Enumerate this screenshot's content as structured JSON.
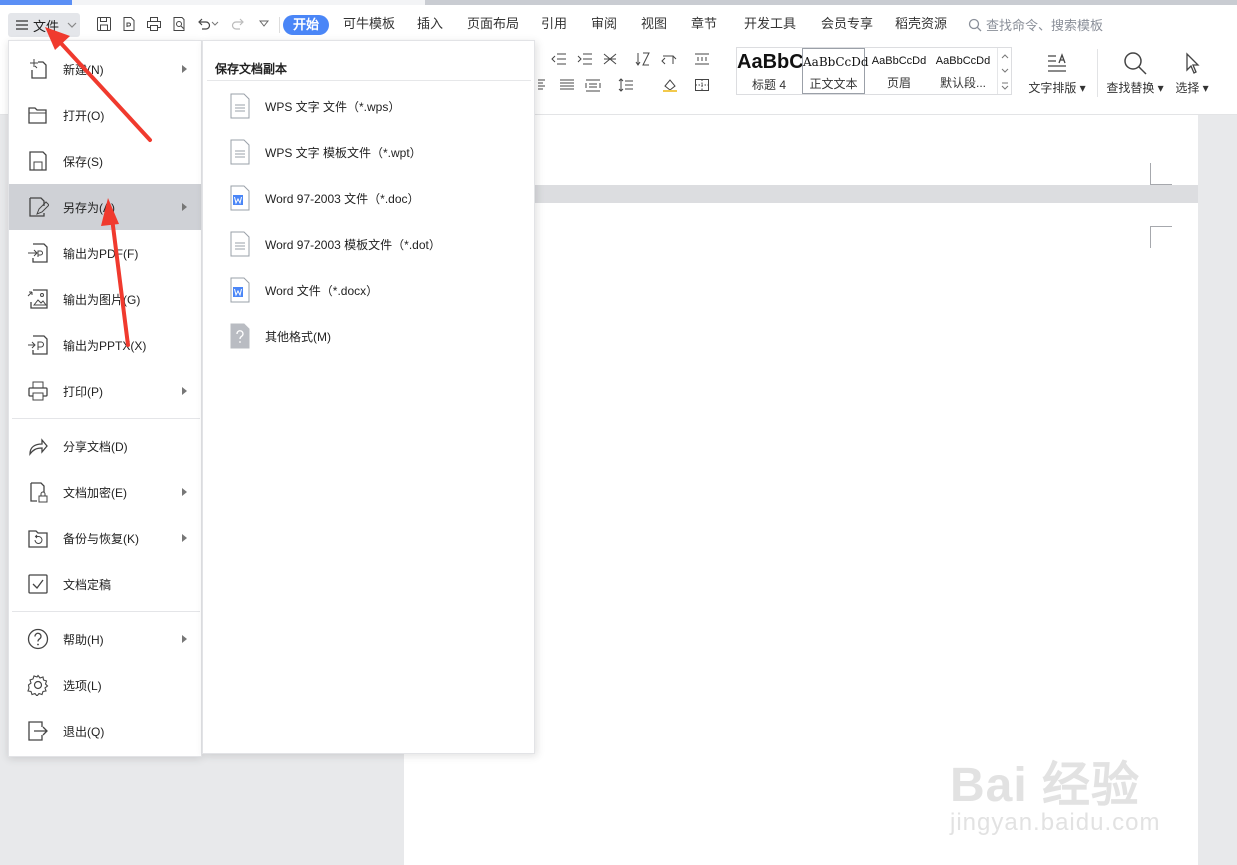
{
  "app": {
    "file_menu_label": "文件",
    "tabs": [
      "开始",
      "可牛模板",
      "插入",
      "页面布局",
      "引用",
      "审阅",
      "视图",
      "章节",
      "开发工具",
      "会员专享",
      "稻壳资源"
    ],
    "search_placeholder": "查找命令、搜索模板"
  },
  "ribbon": {
    "styles": [
      {
        "preview": "AaBbC",
        "name": "标题 4"
      },
      {
        "preview": "AaBbCcDd",
        "name": "正文文本"
      },
      {
        "preview": "AaBbCcDd",
        "name": "页眉"
      },
      {
        "preview": "AaBbCcDd",
        "name": "默认段..."
      }
    ],
    "text_layout": "文字排版",
    "find_replace": "查找替换",
    "select": "选择"
  },
  "file_menu": {
    "items": [
      {
        "label": "新建(N)",
        "icon": "new-doc-icon",
        "submenu": true
      },
      {
        "label": "打开(O)",
        "icon": "folder-icon",
        "submenu": false
      },
      {
        "label": "保存(S)",
        "icon": "save-icon",
        "submenu": false
      },
      {
        "label": "另存为(A)",
        "icon": "save-as-icon",
        "submenu": true
      },
      {
        "label": "输出为PDF(F)",
        "icon": "pdf-export-icon",
        "submenu": false
      },
      {
        "label": "输出为图片(G)",
        "icon": "image-export-icon",
        "submenu": false
      },
      {
        "label": "输出为PPTX(X)",
        "icon": "pptx-export-icon",
        "submenu": false
      },
      {
        "label": "打印(P)",
        "icon": "print-icon",
        "submenu": true
      },
      {
        "label": "分享文档(D)",
        "icon": "share-icon",
        "submenu": false
      },
      {
        "label": "文档加密(E)",
        "icon": "encrypt-icon",
        "submenu": true
      },
      {
        "label": "备份与恢复(K)",
        "icon": "backup-icon",
        "submenu": true
      },
      {
        "label": "文档定稿",
        "icon": "finalize-icon",
        "submenu": false
      },
      {
        "label": "帮助(H)",
        "icon": "help-icon",
        "submenu": true
      },
      {
        "label": "选项(L)",
        "icon": "gear-icon",
        "submenu": false
      },
      {
        "label": "退出(Q)",
        "icon": "exit-icon",
        "submenu": false
      }
    ],
    "selected": "另存为(A)"
  },
  "save_as_menu": {
    "header": "保存文档副本",
    "items": [
      {
        "label": "WPS 文字 文件（*.wps）",
        "icon": "doc-file-icon"
      },
      {
        "label": "WPS 文字 模板文件（*.wpt）",
        "icon": "doc-file-icon"
      },
      {
        "label": "Word 97-2003 文件（*.doc）",
        "icon": "word-file-icon"
      },
      {
        "label": "Word 97-2003 模板文件（*.dot）",
        "icon": "doc-file-icon"
      },
      {
        "label": "Word 文件（*.docx）",
        "icon": "word-file-icon"
      },
      {
        "label": "其他格式(M)",
        "icon": "unknown-file-icon"
      }
    ]
  },
  "watermark": {
    "brand": "Bai 经验",
    "url": "jingyan.baidu.com"
  },
  "colors": {
    "accent": "#4a86f7",
    "arrow": "#f03a2e",
    "selected_item_bg": "#cfd1d6"
  }
}
